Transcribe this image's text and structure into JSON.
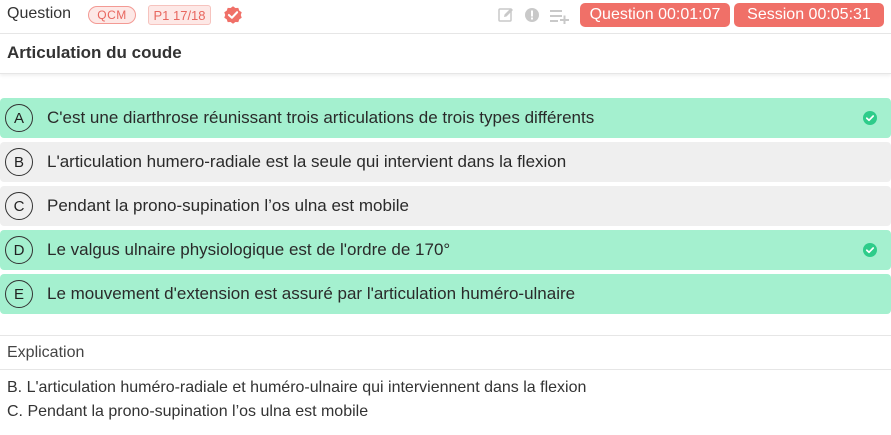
{
  "header": {
    "title": "Question",
    "type_badge": "QCM",
    "progress_badge": "P1 17/18",
    "question_timer": "Question 00:01:07",
    "session_timer": "Session 00:05:31",
    "icons": [
      "verified-icon",
      "edit-icon",
      "info-icon",
      "add-to-list-icon"
    ]
  },
  "question": {
    "title": "Articulation du coude"
  },
  "answers": [
    {
      "letter": "A",
      "text": "C'est une diarthrose réunissant trois articulations de trois types différents",
      "correct": true
    },
    {
      "letter": "B",
      "text": "L'articulation humero-radiale est la seule qui intervient dans la flexion",
      "correct": false
    },
    {
      "letter": "C",
      "text": "Pendant la prono-supination l’os ulna est mobile",
      "correct": false
    },
    {
      "letter": "D",
      "text": "Le valgus ulnaire physiologique est de l'ordre de 170°",
      "correct": true
    },
    {
      "letter": "E",
      "text": "Le mouvement d'extension est assuré par l'articulation huméro-ulnaire",
      "correct": true
    }
  ],
  "explanation": {
    "title": "Explication",
    "lines": [
      "B. L'articulation huméro-radiale et huméro-ulnaire qui interviennent dans la flexion",
      "C. Pendant la prono-supination l’os ulna est mobile"
    ]
  },
  "colors": {
    "accent": "#f07068",
    "correct_bg": "#a4f0cf",
    "neutral_bg": "#efefef",
    "check_green": "#2ecc8a"
  }
}
